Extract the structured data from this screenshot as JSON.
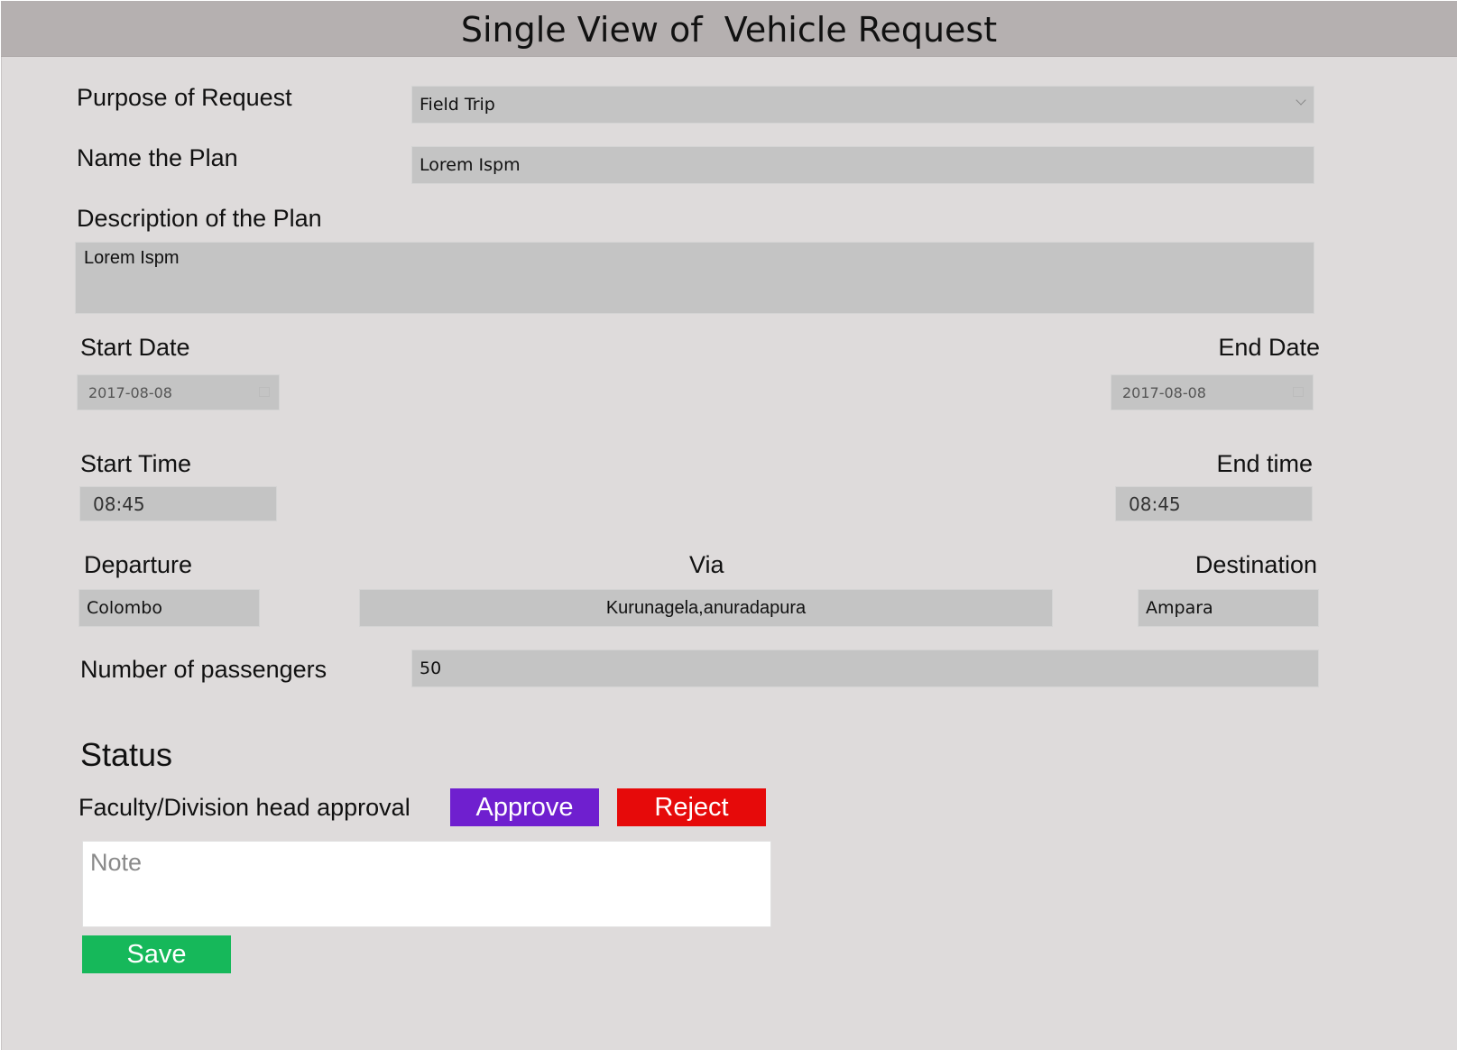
{
  "page": {
    "title": "Single View of  Vehicle Request"
  },
  "form": {
    "purpose": {
      "label": "Purpose of Request",
      "value": "Field Trip"
    },
    "plan_name": {
      "label": "Name the Plan",
      "value": "Lorem Ispm"
    },
    "description": {
      "label": "Description of the Plan",
      "value": "Lorem Ispm"
    },
    "start_date": {
      "label": "Start Date",
      "value": "2017-08-08"
    },
    "end_date": {
      "label": "End Date",
      "value": "2017-08-08"
    },
    "start_time": {
      "label": "Start Time",
      "value": "08:45"
    },
    "end_time": {
      "label": "End time",
      "value": "08:45"
    },
    "departure": {
      "label": "Departure",
      "value": "Colombo"
    },
    "via": {
      "label": "Via",
      "value": "Kurunagela,anuradapura"
    },
    "destination": {
      "label": "Destination",
      "value": "Ampara"
    },
    "passengers": {
      "label": "Number of passengers",
      "value": "50"
    }
  },
  "status": {
    "heading": "Status",
    "approval_label": "Faculty/Division head approval",
    "approve_label": "Approve",
    "reject_label": "Reject",
    "note_placeholder": "Note",
    "save_label": "Save"
  },
  "colors": {
    "approve": "#6f1fcf",
    "reject": "#e60a0a",
    "save": "#16b85a",
    "header_bg": "#b5b0b0",
    "page_bg": "#dedbdb",
    "field_bg": "#c4c4c4"
  },
  "icons": {
    "purpose_dropdown": "chevron-down-icon",
    "start_date_picker": "calendar-icon",
    "end_date_picker": "calendar-icon"
  }
}
